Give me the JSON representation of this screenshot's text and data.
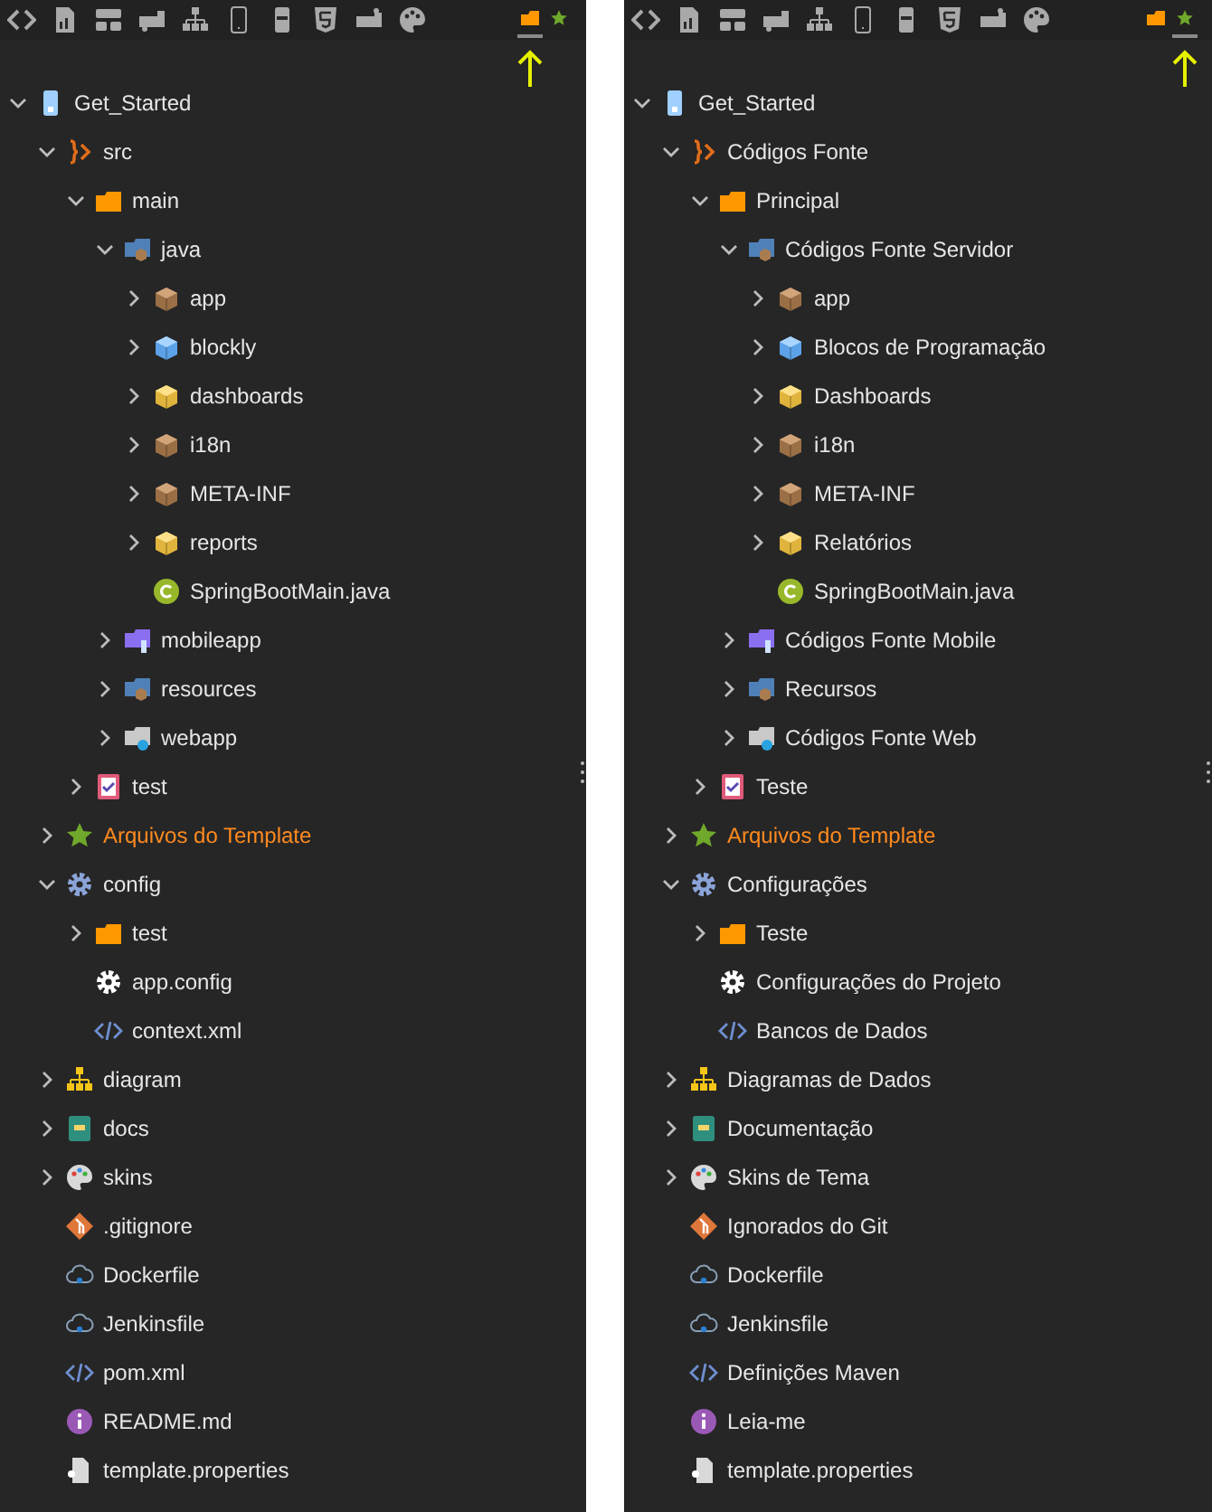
{
  "panels": [
    {
      "view_tabs": [
        {
          "kind": "folder",
          "selected": true
        },
        {
          "kind": "star",
          "selected": false
        }
      ],
      "tree": [
        {
          "label": "Get_Started",
          "kind": "project",
          "expanded": true,
          "children": [
            {
              "label": "src",
              "kind": "source",
              "expanded": true,
              "children": [
                {
                  "label": "main",
                  "kind": "folder",
                  "expanded": true,
                  "children": [
                    {
                      "label": "java",
                      "kind": "java-src",
                      "expanded": true,
                      "children": [
                        {
                          "label": "app",
                          "kind": "package",
                          "expanded": false
                        },
                        {
                          "label": "blockly",
                          "kind": "blockly",
                          "expanded": false
                        },
                        {
                          "label": "dashboards",
                          "kind": "package-open",
                          "expanded": false
                        },
                        {
                          "label": "i18n",
                          "kind": "package",
                          "expanded": false
                        },
                        {
                          "label": "META-INF",
                          "kind": "package",
                          "expanded": false
                        },
                        {
                          "label": "reports",
                          "kind": "package-open",
                          "expanded": false
                        },
                        {
                          "label": "SpringBootMain.java",
                          "kind": "class"
                        }
                      ]
                    },
                    {
                      "label": "mobileapp",
                      "kind": "mobile",
                      "expanded": false
                    },
                    {
                      "label": "resources",
                      "kind": "java-src",
                      "expanded": false
                    },
                    {
                      "label": "webapp",
                      "kind": "web",
                      "expanded": false
                    }
                  ]
                },
                {
                  "label": "test",
                  "kind": "test",
                  "expanded": false
                }
              ]
            },
            {
              "label": "Arquivos do Template",
              "kind": "template",
              "expanded": false
            },
            {
              "label": "config",
              "kind": "config",
              "expanded": true,
              "children": [
                {
                  "label": "test",
                  "kind": "folder",
                  "expanded": false
                },
                {
                  "label": "app.config",
                  "kind": "settings"
                },
                {
                  "label": "context.xml",
                  "kind": "xml"
                }
              ]
            },
            {
              "label": "diagram",
              "kind": "diagram",
              "expanded": false
            },
            {
              "label": "docs",
              "kind": "docs",
              "expanded": false
            },
            {
              "label": "skins",
              "kind": "skins",
              "expanded": false
            },
            {
              "label": ".gitignore",
              "kind": "git"
            },
            {
              "label": "Dockerfile",
              "kind": "cloud"
            },
            {
              "label": "Jenkinsfile",
              "kind": "cloud"
            },
            {
              "label": "pom.xml",
              "kind": "xml"
            },
            {
              "label": "README.md",
              "kind": "info"
            },
            {
              "label": "template.properties",
              "kind": "file"
            }
          ]
        }
      ]
    },
    {
      "view_tabs": [
        {
          "kind": "folder",
          "selected": false
        },
        {
          "kind": "star",
          "selected": true
        }
      ],
      "tree": [
        {
          "label": "Get_Started",
          "kind": "project",
          "expanded": true,
          "children": [
            {
              "label": "Códigos Fonte",
              "kind": "source",
              "expanded": true,
              "children": [
                {
                  "label": "Principal",
                  "kind": "folder",
                  "expanded": true,
                  "children": [
                    {
                      "label": "Códigos Fonte Servidor",
                      "kind": "java-src",
                      "expanded": true,
                      "children": [
                        {
                          "label": "app",
                          "kind": "package",
                          "expanded": false
                        },
                        {
                          "label": "Blocos de Programação",
                          "kind": "blockly",
                          "expanded": false
                        },
                        {
                          "label": "Dashboards",
                          "kind": "package-open",
                          "expanded": false
                        },
                        {
                          "label": "i18n",
                          "kind": "package",
                          "expanded": false
                        },
                        {
                          "label": "META-INF",
                          "kind": "package",
                          "expanded": false
                        },
                        {
                          "label": "Relatórios",
                          "kind": "package-open",
                          "expanded": false
                        },
                        {
                          "label": "SpringBootMain.java",
                          "kind": "class"
                        }
                      ]
                    },
                    {
                      "label": "Códigos Fonte Mobile",
                      "kind": "mobile",
                      "expanded": false
                    },
                    {
                      "label": "Recursos",
                      "kind": "java-src",
                      "expanded": false
                    },
                    {
                      "label": "Códigos Fonte Web",
                      "kind": "web",
                      "expanded": false
                    }
                  ]
                },
                {
                  "label": "Teste",
                  "kind": "test",
                  "expanded": false
                }
              ]
            },
            {
              "label": "Arquivos do Template",
              "kind": "template",
              "expanded": false
            },
            {
              "label": "Configurações",
              "kind": "config",
              "expanded": true,
              "children": [
                {
                  "label": "Teste",
                  "kind": "folder",
                  "expanded": false
                },
                {
                  "label": "Configurações do Projeto",
                  "kind": "settings"
                },
                {
                  "label": "Bancos de Dados",
                  "kind": "xml"
                }
              ]
            },
            {
              "label": "Diagramas de Dados",
              "kind": "diagram",
              "expanded": false
            },
            {
              "label": "Documentação",
              "kind": "docs",
              "expanded": false
            },
            {
              "label": "Skins de Tema",
              "kind": "skins",
              "expanded": false
            },
            {
              "label": "Ignorados do Git",
              "kind": "git"
            },
            {
              "label": "Dockerfile",
              "kind": "cloud"
            },
            {
              "label": "Jenkinsfile",
              "kind": "cloud"
            },
            {
              "label": "Definições Maven",
              "kind": "xml"
            },
            {
              "label": "Leia-me",
              "kind": "info"
            },
            {
              "label": "template.properties",
              "kind": "file"
            }
          ]
        }
      ]
    }
  ]
}
